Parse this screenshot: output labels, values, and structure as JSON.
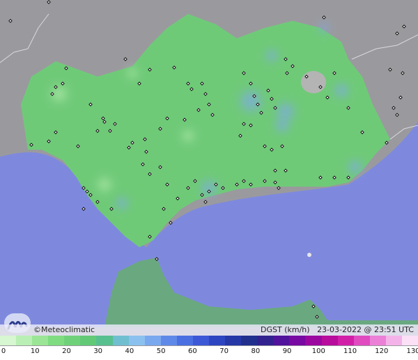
{
  "credit": "©Meteoclimatic",
  "variable_label": "DGST (km/h)",
  "timestamp": "23-03-2022 @ 23:51 UTC",
  "legend_ticks": [
    "0",
    "10",
    "20",
    "30",
    "40",
    "50",
    "60",
    "70",
    "80",
    "90",
    "100",
    "110",
    "120",
    "130"
  ],
  "colors": {
    "sea": "#7e89de",
    "land_outside": "#9a9a9e",
    "region_green": "#6fca78",
    "gust_blue": "#7fa9e6",
    "high_gray": "#b4b4b4"
  },
  "scale_colors": [
    "#d7f6d2",
    "#b9efb4",
    "#9be596",
    "#7fdc80",
    "#6fd27a",
    "#62c977",
    "#58c08f",
    "#6fbfd0",
    "#8bc1ee",
    "#7aa8ee",
    "#5f89e8",
    "#4a6fe0",
    "#3d58d6",
    "#2d45c0",
    "#2638a6",
    "#21308d",
    "#32228f",
    "#51129c",
    "#7809a3",
    "#9a089f",
    "#b80c9c",
    "#d21fa8",
    "#e04bc0",
    "#eb80d6",
    "#f4b3e8",
    "#fbe0f6"
  ]
}
